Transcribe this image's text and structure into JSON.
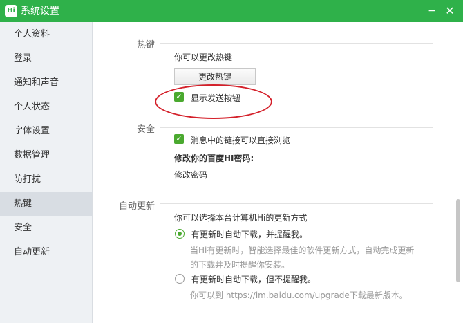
{
  "window": {
    "title": "系统设置",
    "logo_text": "Hi",
    "minimize": "−",
    "close": "✕"
  },
  "sidebar": {
    "items": [
      "个人资料",
      "登录",
      "通知和声音",
      "个人状态",
      "字体设置",
      "数据管理",
      "防打扰",
      "热键",
      "安全",
      "自动更新"
    ],
    "active_index": 7
  },
  "hotkey": {
    "label": "热键",
    "desc": "你可以更改热键",
    "button": "更改热键",
    "show_send_button": "显示发送按钮",
    "show_send_checked": true
  },
  "security": {
    "label": "安全",
    "browse_links": "消息中的链接可以直接浏览",
    "browse_links_checked": true,
    "password_heading": "修改你的百度HI密码:",
    "password_link": "修改密码"
  },
  "update": {
    "label": "自动更新",
    "desc": "你可以选择本台计算机Hi的更新方式",
    "option1": "有更新时自动下载，并提醒我。",
    "option1_desc_line1": "当Hi有更新时，智能选择最佳的软件更新方式，自动完成更新",
    "option1_desc_line2": "的下载并及时提醒你安装。",
    "option2": "有更新时自动下载，但不提醒我。",
    "option2_desc": "你可以到 https://im.baidu.com/upgrade下载最新版本。",
    "selected": 1
  },
  "colors": {
    "accent": "#2fb14a",
    "check": "#4aa92f",
    "annotation": "#d4202a"
  }
}
